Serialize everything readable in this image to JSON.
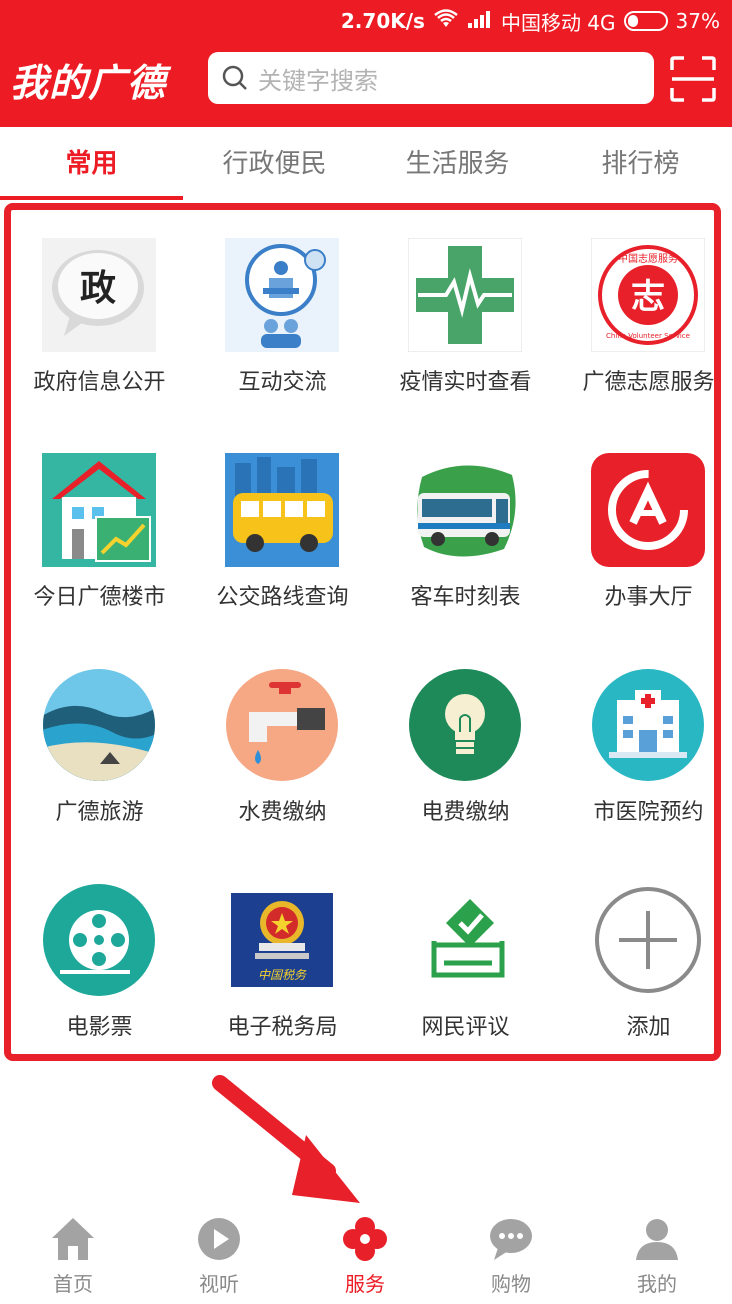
{
  "status_bar": {
    "speed": "2.70K/s",
    "carrier": "中国移动 4G",
    "battery": "37%",
    "battery_level": 0.37
  },
  "header": {
    "brand": "我的广德",
    "search_placeholder": "关键字搜索",
    "color": "#ed1c24"
  },
  "tabs": [
    {
      "label": "常用",
      "active": true
    },
    {
      "label": "行政便民",
      "active": false
    },
    {
      "label": "生活服务",
      "active": false
    },
    {
      "label": "排行榜",
      "active": false
    }
  ],
  "services": [
    {
      "label": "政府信息公开",
      "icon": "gov-info-icon"
    },
    {
      "label": "互动交流",
      "icon": "interaction-icon"
    },
    {
      "label": "疫情实时查看",
      "icon": "medical-cross-icon"
    },
    {
      "label": "广德志愿服务",
      "icon": "volunteer-icon",
      "icon_text": "志",
      "icon_ring_text": "中国志愿服务",
      "icon_ring_text_en": "China Volunteer Service"
    },
    {
      "label": "今日广德楼市",
      "icon": "house-market-icon"
    },
    {
      "label": "公交路线查询",
      "icon": "bus-icon"
    },
    {
      "label": "客车时刻表",
      "icon": "coach-icon"
    },
    {
      "label": "办事大厅",
      "icon": "service-hall-icon"
    },
    {
      "label": "广德旅游",
      "icon": "tourism-icon"
    },
    {
      "label": "水费缴纳",
      "icon": "water-tap-icon"
    },
    {
      "label": "电费缴纳",
      "icon": "light-bulb-icon"
    },
    {
      "label": "市医院预约",
      "icon": "hospital-icon"
    },
    {
      "label": "电影票",
      "icon": "film-reel-icon"
    },
    {
      "label": "电子税务局",
      "icon": "tax-bureau-icon",
      "icon_text": "中国税务"
    },
    {
      "label": "网民评议",
      "icon": "ballot-icon"
    },
    {
      "label": "添加",
      "icon": "add-icon"
    }
  ],
  "bottom_nav": [
    {
      "label": "首页",
      "icon": "home-icon",
      "active": false
    },
    {
      "label": "视听",
      "icon": "play-icon",
      "active": false
    },
    {
      "label": "服务",
      "icon": "clover-icon",
      "active": true
    },
    {
      "label": "购物",
      "icon": "chat-icon",
      "active": false
    },
    {
      "label": "我的",
      "icon": "person-icon",
      "active": false
    }
  ]
}
